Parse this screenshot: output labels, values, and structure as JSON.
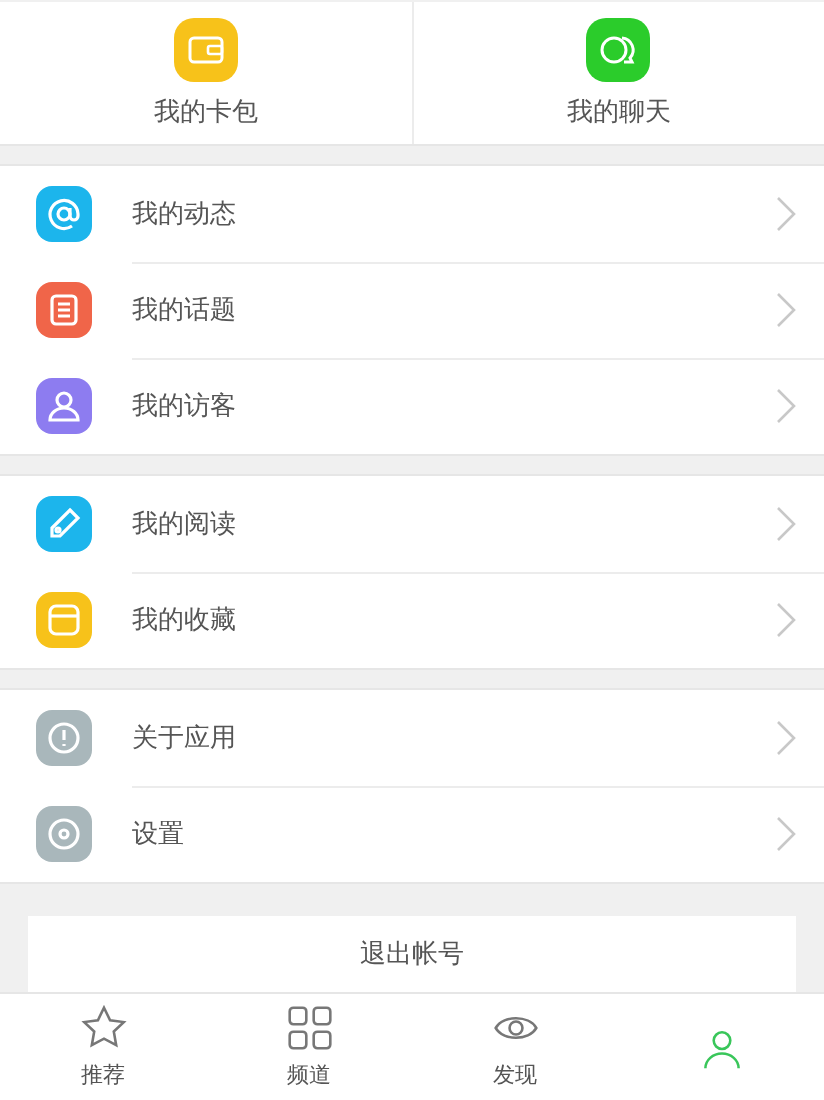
{
  "shortcuts": [
    {
      "label": "我的卡包"
    },
    {
      "label": "我的聊天"
    }
  ],
  "groups": [
    [
      {
        "label": "我的动态"
      },
      {
        "label": "我的话题"
      },
      {
        "label": "我的访客"
      }
    ],
    [
      {
        "label": "我的阅读"
      },
      {
        "label": "我的收藏"
      }
    ],
    [
      {
        "label": "关于应用"
      },
      {
        "label": "设置"
      }
    ]
  ],
  "logout": "退出帐号",
  "tabs": [
    {
      "label": "推荐",
      "selected": false
    },
    {
      "label": "频道",
      "selected": false
    },
    {
      "label": "发现",
      "selected": false
    },
    {
      "selected": true
    }
  ]
}
